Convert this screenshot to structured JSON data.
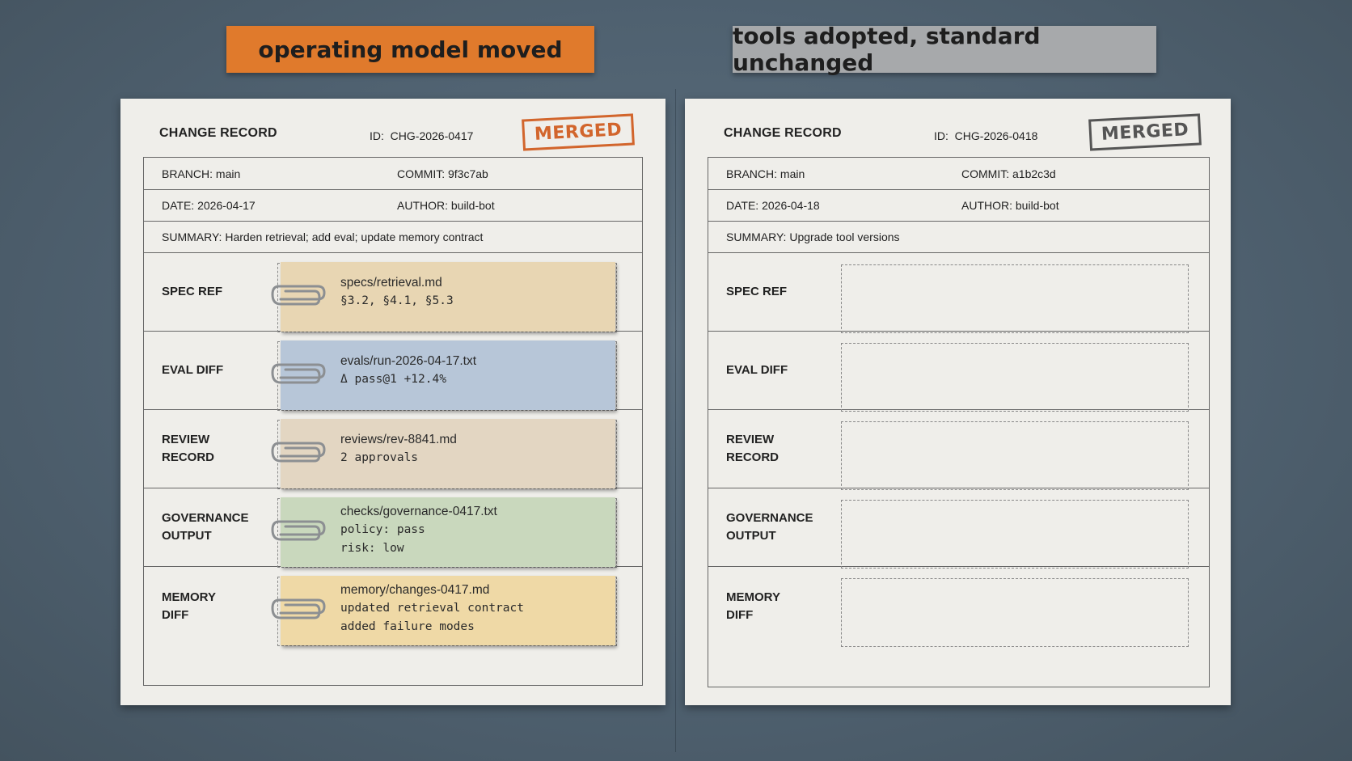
{
  "banners": {
    "left": "operating model moved",
    "right": "tools adopted, standard unchanged"
  },
  "colors": {
    "background": "#4f6170",
    "left_banner": "#e07a2c",
    "right_banner": "#a7a9ab",
    "paper": "#efeeea",
    "left_stamp": "#d2652c",
    "right_stamp": "#555555",
    "note_spec": "#e8d6b3",
    "note_eval": "#b7c6d8",
    "note_review": "#e3d6c2",
    "note_governance": "#c9d8bd",
    "note_memory": "#efd9a6"
  },
  "left_record": {
    "title": "CHANGE RECORD",
    "id_label": "ID:",
    "id_value": "CHG-2026-0417",
    "stamp": "MERGED",
    "branch_label": "BRANCH:",
    "branch_value": "main",
    "commit_label": "COMMIT:",
    "commit_value": "9f3c7ab",
    "date_label": "DATE:",
    "date_value": "2026-04-17",
    "author_label": "AUTHOR:",
    "author_value": "build-bot",
    "summary_label": "SUMMARY:",
    "summary_value": "Harden retrieval; add eval; update memory contract",
    "sections": [
      {
        "label": "SPEC REF",
        "file": "specs/retrieval.md",
        "detail": "§3.2, §4.1, §5.3"
      },
      {
        "label": "EVAL DIFF",
        "file": "evals/run-2026-04-17.txt",
        "detail": "Δ pass@1 +12.4%"
      },
      {
        "label": "REVIEW\nRECORD",
        "file": "reviews/rev-8841.md",
        "detail": "2 approvals"
      },
      {
        "label": "GOVERNANCE\nOUTPUT",
        "file": "checks/governance-0417.txt",
        "detail": "policy: pass\nrisk: low"
      },
      {
        "label": "MEMORY\nDIFF",
        "file": "memory/changes-0417.md",
        "detail": "updated retrieval contract\nadded failure modes"
      }
    ]
  },
  "right_record": {
    "title": "CHANGE RECORD",
    "id_label": "ID:",
    "id_value": "CHG-2026-0418",
    "stamp": "MERGED",
    "branch_label": "BRANCH:",
    "branch_value": "main",
    "commit_label": "COMMIT:",
    "commit_value": "a1b2c3d",
    "date_label": "DATE:",
    "date_value": "2026-04-18",
    "author_label": "AUTHOR:",
    "author_value": "build-bot",
    "summary_label": "SUMMARY:",
    "summary_value": "Upgrade tool versions",
    "sections": [
      {
        "label": "SPEC REF"
      },
      {
        "label": "EVAL DIFF"
      },
      {
        "label": "REVIEW\nRECORD"
      },
      {
        "label": "GOVERNANCE\nOUTPUT"
      },
      {
        "label": "MEMORY\nDIFF"
      }
    ]
  },
  "icons": {
    "attachment": "paperclip-icon"
  }
}
